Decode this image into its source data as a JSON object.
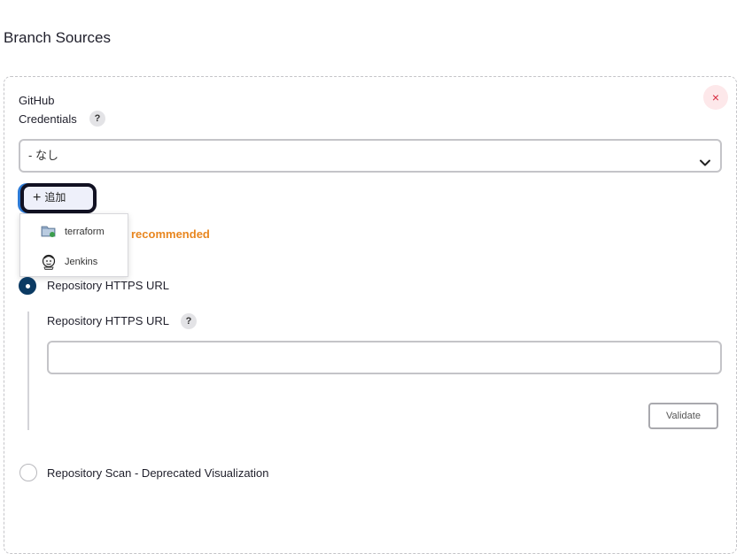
{
  "section": {
    "title": "Branch Sources"
  },
  "card": {
    "close_icon": "×",
    "provider": "GitHub",
    "credentials_label": "Credentials",
    "help_mark": "?",
    "credentials_select": {
      "value": "- なし"
    },
    "add_button": {
      "label": "追加",
      "icon": "plus-icon"
    },
    "add_menu": [
      {
        "label": "terraform",
        "icon": "folder-icon"
      },
      {
        "label": "Jenkins",
        "icon": "jenkins-icon"
      }
    ],
    "recommended_text": "recommended",
    "options": {
      "https": {
        "label": "Repository HTTPS URL",
        "selected": true
      },
      "scan": {
        "label": "Repository Scan - Deprecated Visualization",
        "selected": false
      }
    },
    "repo_url": {
      "label": "Repository HTTPS URL",
      "value": ""
    },
    "validate_label": "Validate"
  },
  "colors": {
    "accent": "#0b3a63",
    "warning": "#e8861f",
    "danger": "#d6263b"
  }
}
